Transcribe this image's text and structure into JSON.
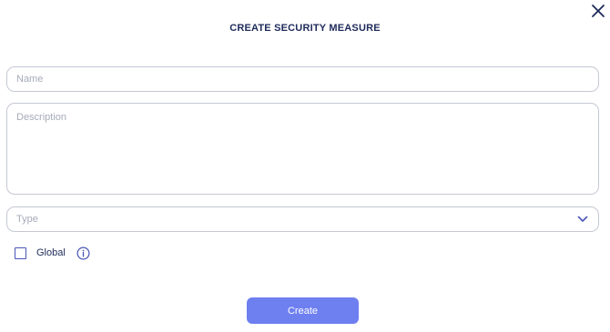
{
  "dialog": {
    "title": "CREATE SECURITY MEASURE",
    "close_icon": "close-icon"
  },
  "form": {
    "name": {
      "value": "",
      "placeholder": "Name"
    },
    "description": {
      "value": "",
      "placeholder": "Description"
    },
    "type": {
      "selected": "",
      "placeholder": "Type",
      "icon": "chevron-down-icon"
    },
    "global": {
      "label": "Global",
      "checked": false,
      "info_icon": "info-icon"
    }
  },
  "actions": {
    "create_label": "Create"
  },
  "colors": {
    "title": "#1e2a5a",
    "accent": "#4a56b8",
    "button_bg": "#6e7ff0",
    "field_border": "#c5c8d4",
    "placeholder": "#a6abba"
  }
}
